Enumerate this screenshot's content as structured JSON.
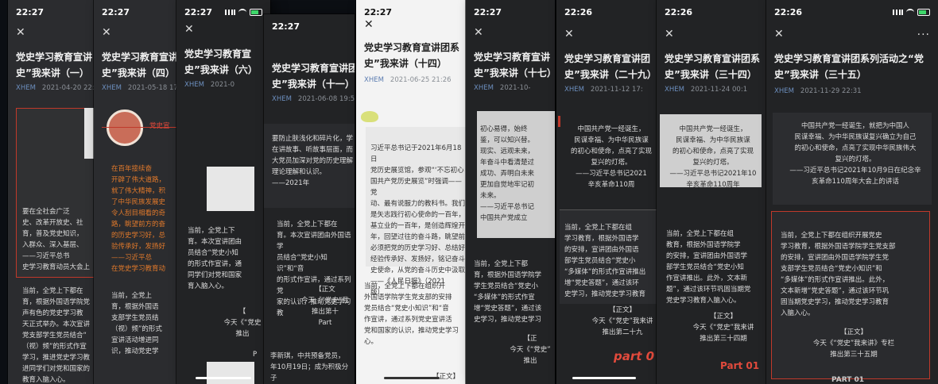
{
  "screens": [
    {
      "time": "22:27",
      "title": [
        "党史学习教育宣讲",
        "史”我来讲（一）"
      ],
      "source": "XHEM",
      "date": "2021-04-20 22:5",
      "p1": "要在全社会广泛\n史、改革开放史、社\n育，普及党史知识，\n入群众、深入基层、\n——习近平总书\n史学习教育动员大会上",
      "p2": "当前，全党上下都在\n育，根据外国语学院党\n声有色的党史学习教\n天正式举办。本次宣讲\n党支部学生党员结合“\n（视）频”的形式作宣\n学习，推进党史学习教\n进同学们对党和国家的\n教育入脑入心。"
    },
    {
      "time": "22:27",
      "title": [
        "党史学习教育宣讲",
        "史”我来讲（四）"
      ],
      "source": "XHEM",
      "date": "2021-05-18 17:3",
      "banner": "党史宣",
      "p1": "在百年接续奋\n开辟了伟大道路，\n就了伟大精神，积\n了中华民族发展史\n令人刮目相看的奇\n路，眺望前方的奋\n的历史学习好，总\n验传承好，发扬好\n——习近平总\n在党史学习教育动",
      "p2": "当前，全党上\n育，根据外国语\n支部学生党员结\n（视）频”的形式\n宣讲活动增进同\n识，推动党史学"
    },
    {
      "time": "22:27",
      "title": [
        "党史学习教育宣",
        "史”我来讲（六）"
      ],
      "source": "XHEM",
      "date": "2021-0",
      "p1": "当前，全党上下\n育。本次宣讲团由\n员结合“党史小知\n的形式作宣讲，通\n同学们对党和国家\n育入脑入心。",
      "p2": "【\n今天《“党史\n推出",
      "p3": "P"
    },
    {
      "time": "22:27",
      "title": [
        "党史学习教育宣讲团",
        "史”我来讲（十一）"
      ],
      "source": "XHEM",
      "date": "2021-06-08 19:54",
      "p1": "要防止肤浅化和碎片化，学\n在讲故事、听故事层面，而\n大党员加深对党的历史理解\n理论理解和认识。\n——2021年",
      "p2": "当前，全党上下都在\n育。本次宣讲团由外国语学\n员结合“党史小知识”和“音\n的形式作宣讲，通过系列党\n家的认识，推动党史学习教",
      "p3": "【正文\n今天《“党史”我\n推出第十\nPart",
      "p4": "李新琪，中共预备党员，\n年10月19日；成为积极分子"
    },
    {
      "time": "22:27",
      "title": [
        "党史学习教育宣讲团系",
        "史”我来讲（十四）"
      ],
      "source": "XHEM",
      "date": "2021-06-25 21:26",
      "p1": "习近平总书记于2021年6月18日\n党历史展览馆，参观“‘不忘初心\n国共产党历史展览”时强调——党\n动、最有说服力的教科书。我们\n是矢志践行初心使命的一百年，\n基立业的一百年，是创造辉煌开\n年，回望过往的奋斗路，眺望前\n必须把党的历史学习好、总结好\n经验传承好、发扬好，铭记奋斗\n史使命，从党的奋斗历史中汲取\n——《人民日报》（2021\n版）",
      "p2": "当前，全党上下都在组织开\n外国语学院学生党支部的安排\n党员结合“党史小知识”和“音\n作宣讲，通过系列党史宣讲活\n党和国家的认识，推动党史学习\n心。",
      "p3": "【正文】"
    },
    {
      "time": "22:27",
      "title": [
        "党史学习教育宣讲",
        "史”我来讲（十七）"
      ],
      "source": "XHEM",
      "date": "2021-10-",
      "p1": "初心易得，始终\n鉴，可以知兴替。\n现实、远观未来，\n年奋斗中看清楚过\n成功、弄明白未来\n更加自觉地牢记初\n未来。\n——习近平总书记\n中国共产党成立",
      "p2": "当前，全党上下都\n育，根据外国语学院学\n学生党员结合“党史小\n“多媒体”的形式作宣\n增“党史答题”，通过该\n史学习，推动党史学习",
      "p3": "【正\n今天《“党史”\n推出"
    },
    {
      "time": "22:26",
      "title": [
        "党史学习教育宣讲团",
        "史”我来讲（二十九）"
      ],
      "source": "XHEM",
      "date": "2021-11-12 17:",
      "p1": "中国共产党一经诞生，\n民谋幸福、为中华民族谋\n的初心和使命，点亮了实现\n复兴的灯塔。\n——习近平总书记2021\n辛亥革命110周",
      "p2": "当前，全党上下都在组\n学习教育，根据外国语学\n的安排，宣讲团由外国语\n部学生党员结合“党史小\n“多媒体”的形式作宣讲推出\n增“党史答题”，通过该环\n史学习，推动党史学习教育",
      "p3": "【正文】\n今天《“党史”我来讲\n推出第二十九",
      "part": "part 0"
    },
    {
      "time": "22:26",
      "title": [
        "党史学习教育宣讲团系",
        "史”我来讲（三十四）"
      ],
      "source": "XHEM",
      "date": "2021-11-24 00:1",
      "p1": "中国共产党一经诞生，\n民谋幸福、为中华民族谋\n的初心和使命，点亮了实现\n复兴的灯塔。\n——习近平总书记2021年10\n辛亥革命110周年",
      "p2": "当前，全党上下都在组\n教育，根据外国语学院学\n的安排，宣讲团由外国语学\n部学生党员结合“党史小知\n作宣讲推出。此外，文本新\n题”，通过该环节巩固当期党\n党史学习教育入脑入心。",
      "p3": "【正文】\n今天《“党史”我来讲\n推出第三十四期",
      "part": "Part 01"
    },
    {
      "time": "22:26",
      "title": [
        "党史学习教育宣讲团系列活动之“党",
        "史”我来讲（三十五）"
      ],
      "source": "XHEM",
      "date": "2021-11-29 22:31",
      "p1": "中国共产党一经诞生，就把为中国人\n民谋幸福、为中华民族谋复兴确立为自己\n的初心和使命，点亮了实现中华民族伟大\n复兴的灯塔。\n——习近平总书记2021年10月9日在纪念辛\n亥革命110周年大会上的讲话",
      "p2": "当前，全党上下都在组织开展党史\n学习教育，根据外国语学院学生党支部\n的安排，宣讲团由外国语学院学生党\n支部学生党员结合“党史小知识”和\n“多媒体”的形式作宣讲推出。此外，\n文本新增“党史答题”，通过该环节巩\n固当期党史学习，推动党史学习教育\n入脑入心。",
      "p3": "【正文】\n今天《“党史”我来讲》专栏\n推出第三十五期",
      "part": "PART 01"
    }
  ]
}
